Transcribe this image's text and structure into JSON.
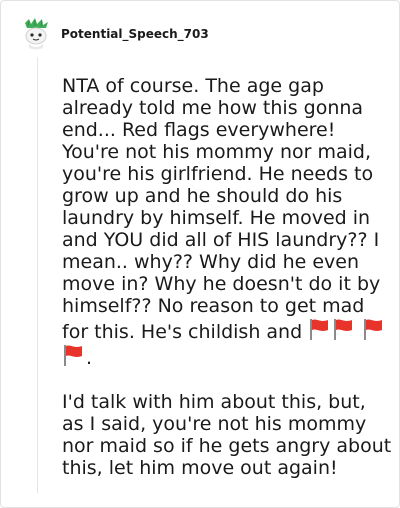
{
  "comment": {
    "username": "Potential_Speech_703",
    "paragraph1_text": "NTA of course. The age gap already told me how this gonna end... Red flags everywhere! You're not his mommy nor maid, you're his girlfriend. He needs to grow up and he should do his laundry by himself. He moved in and YOU did all of HIS laundry?? I mean.. why?? Why did he even move in? Why he doesn't do it by himself?? No reason to get mad for this. He's childish and",
    "paragraph1_end": ".",
    "paragraph2_text": "I'd talk with him about this, but, as I said, you're not his mommy nor maid so if he gets angry about this, let him move out again!",
    "flag_emoji_count": 4
  },
  "colors": {
    "text": "#1a1a1b",
    "border": "#e2e2e2",
    "flag_red": "#e8332a",
    "pole_gray": "#8a8a8a"
  },
  "icons": {
    "avatar": "snoo-avatar-icon",
    "flag": "red-flag-icon"
  }
}
